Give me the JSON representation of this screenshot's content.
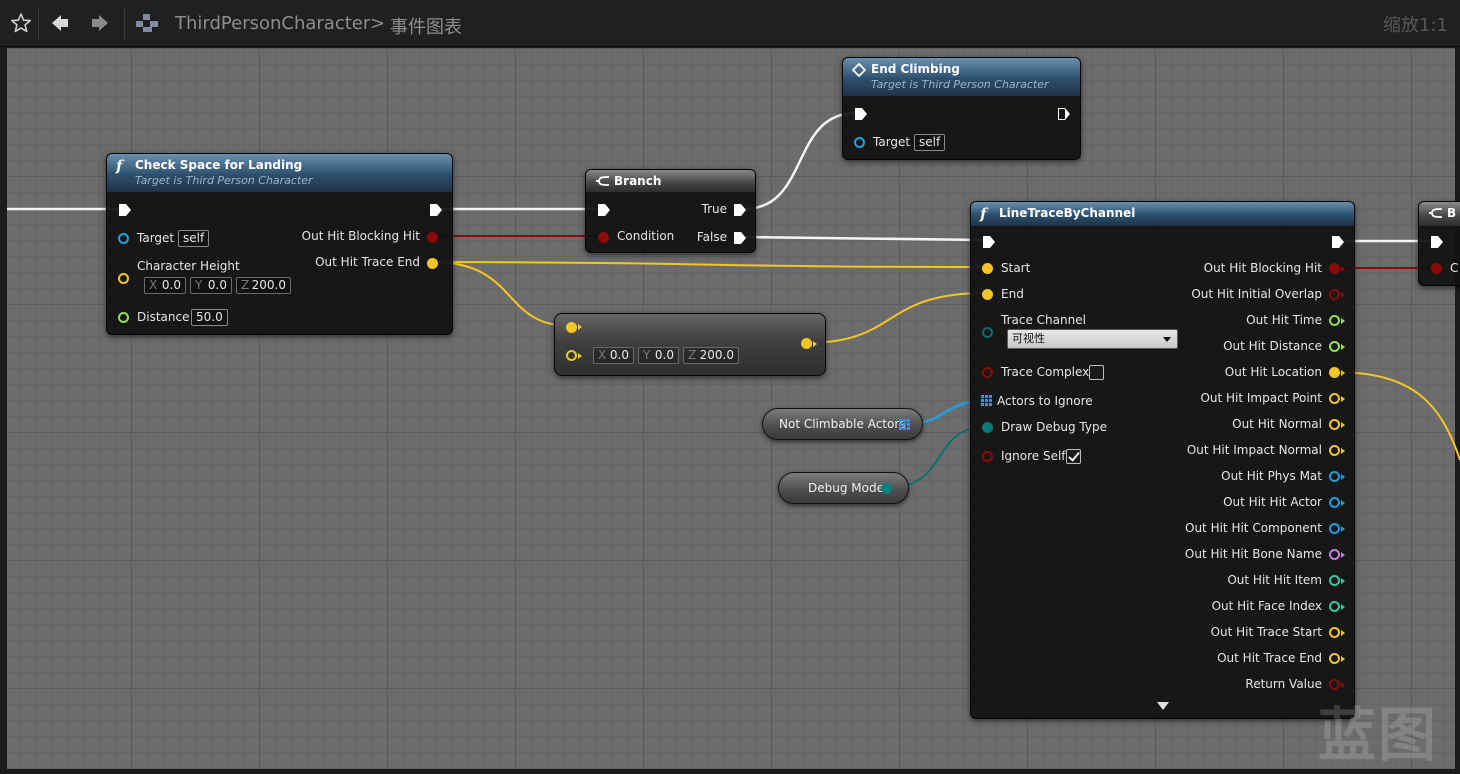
{
  "breadcrumb": {
    "graph": "ThirdPersonCharacter",
    "separator": ">",
    "page": "事件图表"
  },
  "zoom_label": "缩放1:1",
  "watermark": "蓝图",
  "colors": {
    "exec": "#ffffff",
    "bool": "#8c0a0a",
    "vector": "#f3c623",
    "object": "#1aa1e0",
    "float": "#90e050",
    "enum": "#0a6d6d",
    "name": "#c67ae0",
    "struct": "#1e8aa0",
    "int": "#2dcaa0"
  },
  "nodes": {
    "check_space": {
      "title": "Check Space for Landing",
      "subtitle": "Target is Third Person Character",
      "target_label": "Target",
      "target_value": "self",
      "char_height_label": "Character Height",
      "vec": {
        "x_axis": "X",
        "x": "0.0",
        "y_axis": "Y",
        "y": "0.0",
        "z_axis": "Z",
        "z": "200.0"
      },
      "distance_label": "Distance",
      "distance_value": "50.0",
      "out_blocking": "Out Hit Blocking Hit",
      "out_trace_end": "Out Hit Trace End"
    },
    "branch": {
      "title": "Branch",
      "condition": "Condition",
      "true_label": "True",
      "false_label": "False"
    },
    "end_climbing": {
      "title": "End Climbing",
      "subtitle": "Target is Third Person Character",
      "target_label": "Target",
      "target_value": "self"
    },
    "vector_add": {
      "vec": {
        "x_axis": "X",
        "x": "0.0",
        "y_axis": "Y",
        "y": "0.0",
        "z_axis": "Z",
        "z": "200.0"
      }
    },
    "not_climbable": {
      "label": "Not Climbable Actors"
    },
    "debug_mode": {
      "label": "Debug Mode"
    },
    "line_trace": {
      "title": "LineTraceByChannel",
      "inputs": {
        "start": "Start",
        "end": "End",
        "trace_channel": "Trace Channel",
        "trace_channel_value": "可视性",
        "trace_complex": "Trace Complex",
        "actors_to_ignore": "Actors to Ignore",
        "draw_debug_type": "Draw Debug Type",
        "ignore_self": "Ignore Self"
      },
      "outputs": [
        {
          "label": "Out Hit Blocking Hit",
          "type": "bool",
          "filled": true
        },
        {
          "label": "Out Hit Initial Overlap",
          "type": "bool",
          "filled": false
        },
        {
          "label": "Out Hit Time",
          "type": "float",
          "filled": false
        },
        {
          "label": "Out Hit Distance",
          "type": "float",
          "filled": false
        },
        {
          "label": "Out Hit Location",
          "type": "vector",
          "filled": true
        },
        {
          "label": "Out Hit Impact Point",
          "type": "vector",
          "filled": false
        },
        {
          "label": "Out Hit Normal",
          "type": "vector",
          "filled": false
        },
        {
          "label": "Out Hit Impact Normal",
          "type": "vector",
          "filled": false
        },
        {
          "label": "Out Hit Phys Mat",
          "type": "object",
          "filled": false
        },
        {
          "label": "Out Hit Hit Actor",
          "type": "object",
          "filled": false
        },
        {
          "label": "Out Hit Hit Component",
          "type": "object",
          "filled": false
        },
        {
          "label": "Out Hit Hit Bone Name",
          "type": "name",
          "filled": false
        },
        {
          "label": "Out Hit Hit Item",
          "type": "int",
          "filled": false
        },
        {
          "label": "Out Hit Face Index",
          "type": "int",
          "filled": false
        },
        {
          "label": "Out Hit Trace Start",
          "type": "vector",
          "filled": false
        },
        {
          "label": "Out Hit Trace End",
          "type": "vector",
          "filled": false
        },
        {
          "label": "Return Value",
          "type": "bool",
          "filled": false
        }
      ]
    },
    "offscreen": {
      "title": "B",
      "pin": "C"
    }
  }
}
